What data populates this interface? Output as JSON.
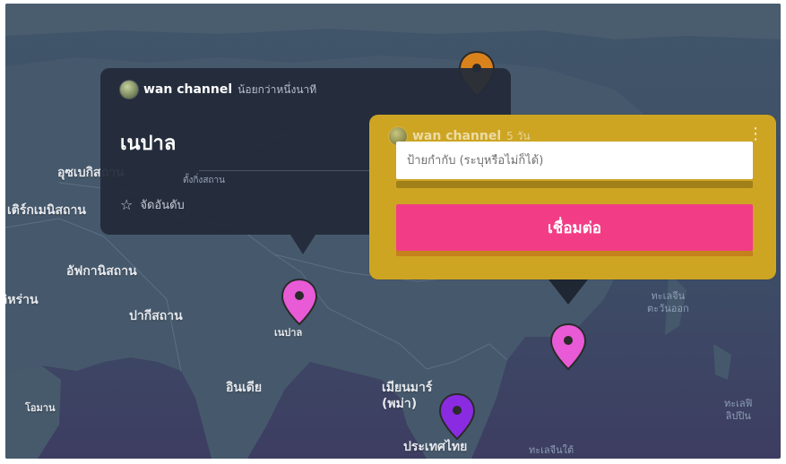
{
  "map": {
    "labels": [
      {
        "id": "nepal-pin-label",
        "text": "เนปาล"
      },
      {
        "id": "uzbekistan",
        "text": "อุซเบกิสถาน"
      },
      {
        "id": "turkmenistan",
        "text": "เติร์กเมนิสถาน"
      },
      {
        "id": "afghanistan",
        "text": "อัฟกานิสถาน"
      },
      {
        "id": "iran",
        "text": "อิหร่าน"
      },
      {
        "id": "pakistan",
        "text": "ปากีสถาน"
      },
      {
        "id": "india",
        "text": "อินเดีย"
      },
      {
        "id": "oman",
        "text": "โอมาน"
      },
      {
        "id": "myanmar",
        "text": "เมียนมาร์\n(พม่า)"
      },
      {
        "id": "thailand",
        "text": "ประเทศไทย"
      },
      {
        "id": "south-china-sea",
        "text": "ทะเลจีนใต้"
      },
      {
        "id": "east-china-sea",
        "text": "ทะเลจีน\nตะวันออก"
      },
      {
        "id": "philippine-sea",
        "text": "ทะเลฟิ\nลิปปิน"
      }
    ],
    "pins": [
      {
        "id": "pin-top-orange",
        "color": "#d9821c"
      },
      {
        "id": "pin-nepal",
        "color": "#e85ad6"
      },
      {
        "id": "pin-east",
        "color": "#e85ad6"
      },
      {
        "id": "pin-thailand",
        "color": "#8a2be2"
      }
    ]
  },
  "tooltip": {
    "channel": "wan channel",
    "time": "น้อยกว่าหนึ่งนาที",
    "title": "เนปาล",
    "subtitle": "ตั้งกิ่งสถาน",
    "rank_label": "จัดอันดับ"
  },
  "modal": {
    "channel": "wan channel",
    "time": "5 วัน",
    "input_placeholder": "ป้ายกำกับ (ระบุหรือไม่ก็ได้)",
    "input_value": "",
    "connect_label": "เชื่อมต่อ"
  },
  "colors": {
    "accent_pink": "#f23d86",
    "modal_gold": "#cda523",
    "map_bg": "#41556a"
  }
}
